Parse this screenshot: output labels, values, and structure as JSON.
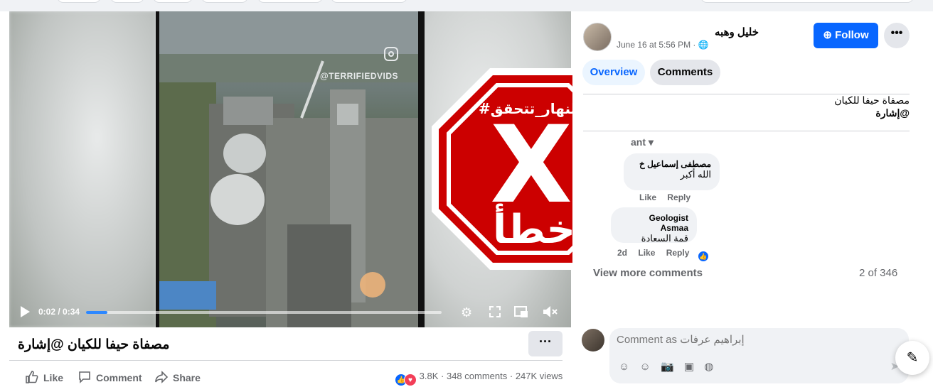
{
  "post": {
    "title": "مصفاة حيفا للكيان @إشارة",
    "video": {
      "current_time": "0:02",
      "duration": "0:34",
      "time_display": "0:02 / 0:34",
      "progress": 0.059,
      "watermark": "@TERRIFIEDVIDS",
      "overlay_hashtag": "#النهار_تتحقق",
      "overlay_verdict": "خطأ",
      "overlay_mark": "X"
    },
    "actions": {
      "like": "Like",
      "comment": "Comment",
      "share": "Share"
    },
    "stats": {
      "reactions": "3.8K",
      "comments": "348 comments",
      "views": "247K views",
      "sep": "·"
    }
  },
  "sidebar": {
    "author": "خليل وهبه",
    "timestamp": "June 16 at 5:56 PM ·",
    "follow_label": "Follow",
    "more_label": "•••",
    "tabs": [
      {
        "label": "Overview",
        "active": true
      },
      {
        "label": "Comments",
        "active": false
      }
    ],
    "description_line1": "مصفاة حيفا للكيان",
    "description_tag": "@إشارة",
    "sort_label": "ant",
    "comments": [
      {
        "name": "مصطفى إسماعيل خ",
        "text": "الله أكبر",
        "like": "Like",
        "reply": "Reply"
      },
      {
        "name": "Geologist Asmaa",
        "text": "قمة السعادة",
        "age": "2d",
        "like": "Like",
        "reply": "Reply"
      }
    ],
    "view_more": "View more comments",
    "count": "2 of 346",
    "comment_placeholder": "Comment as إبراهيم عرفات"
  },
  "colors": {
    "accent": "#0866ff",
    "stop_red": "#d0021b"
  }
}
